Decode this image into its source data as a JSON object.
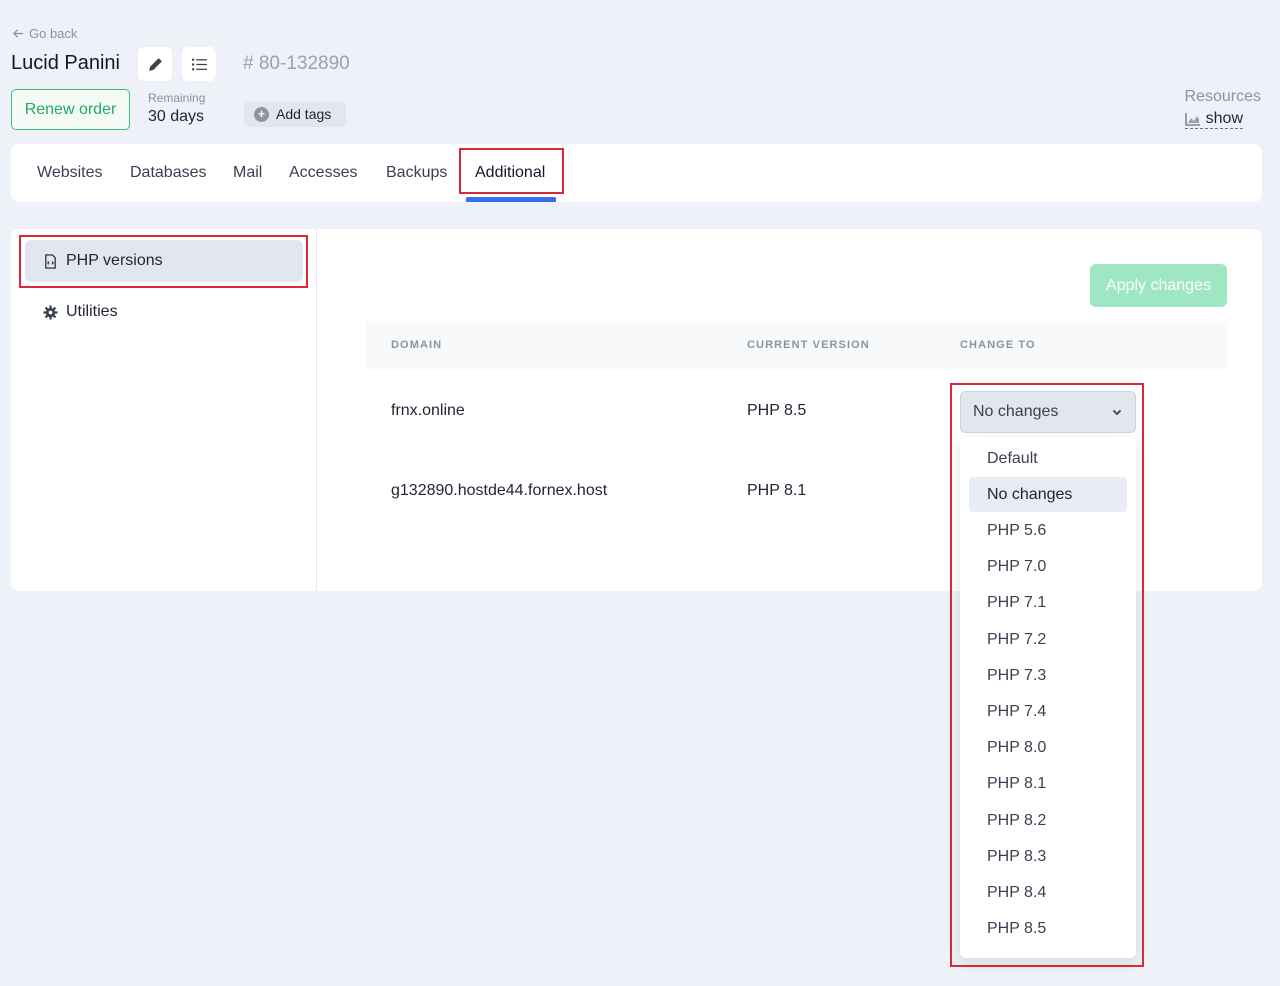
{
  "header": {
    "go_back": "Go back",
    "title": "Lucid Panini",
    "order_id": "# 80-132890",
    "renew_label": "Renew order",
    "remaining_label": "Remaining",
    "remaining_value": "30 days",
    "add_tags_label": "Add tags",
    "resources_label": "Resources",
    "resources_show": "show"
  },
  "tabs": [
    "Websites",
    "Databases",
    "Mail",
    "Accesses",
    "Backups",
    "Additional"
  ],
  "active_tab": "Additional",
  "sidebar": {
    "items": [
      "PHP versions",
      "Utilities"
    ],
    "active": "PHP versions"
  },
  "apply_label": "Apply changes",
  "table": {
    "headers": [
      "DOMAIN",
      "CURRENT VERSION",
      "CHANGE TO"
    ],
    "rows": [
      {
        "domain": "frnx.online",
        "current": "PHP 8.5",
        "change_to": "No changes"
      },
      {
        "domain": "g132890.hostde44.fornex.host",
        "current": "PHP 8.1",
        "change_to": ""
      }
    ]
  },
  "dropdown": {
    "selected": "No changes",
    "options": [
      "Default",
      "No changes",
      "PHP 5.6",
      "PHP 7.0",
      "PHP 7.1",
      "PHP 7.2",
      "PHP 7.3",
      "PHP 7.4",
      "PHP 8.0",
      "PHP 8.1",
      "PHP 8.2",
      "PHP 8.3",
      "PHP 8.4",
      "PHP 8.5"
    ]
  },
  "colors": {
    "accent": "#3a6ee8",
    "renew": "#24a866",
    "apply_disabled": "#9fe6c2",
    "highlight": "#d62b35"
  }
}
